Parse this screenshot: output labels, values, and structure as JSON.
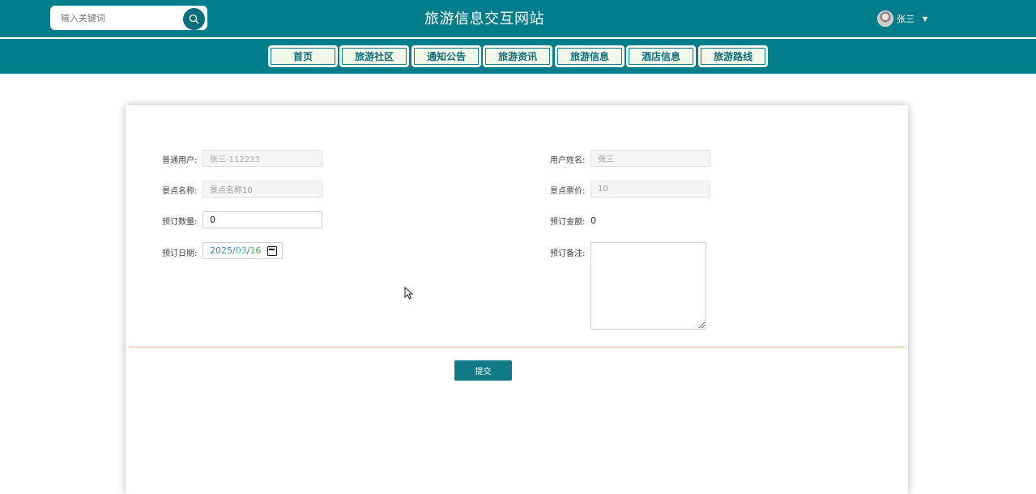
{
  "header": {
    "title": "旅游信息交互网站",
    "search_placeholder": "输入关键词",
    "user_name": "张三"
  },
  "nav": {
    "items": [
      {
        "label": "首页"
      },
      {
        "label": "旅游社区"
      },
      {
        "label": "通知公告"
      },
      {
        "label": "旅游资讯"
      },
      {
        "label": "旅游信息"
      },
      {
        "label": "酒店信息"
      },
      {
        "label": "旅游路线"
      }
    ]
  },
  "form": {
    "user_label": "普通用户:",
    "user_placeholder": "张三-112233",
    "name_label": "用户姓名:",
    "name_value": "张三",
    "spot_label": "景点名称:",
    "spot_value": "景点名称10",
    "price_label": "景点票价:",
    "price_value": "10",
    "qty_label": "预订数量:",
    "qty_value": "0",
    "amount_label": "预订金额:",
    "amount_value": "0",
    "date_label": "预订日期:",
    "date_year": "2025",
    "date_month": "03",
    "date_day": "16",
    "remark_label": "预订备注:",
    "submit_label": "提交"
  },
  "colors": {
    "header_bg": "#017d8c",
    "nav_item_bg": "#f1f7e9",
    "nav_text": "#0e6d79",
    "submit_bg": "#107b87",
    "divider": "#f0a88f"
  },
  "icons": {
    "search": "search-icon",
    "avatar": "avatar",
    "dropdown": "caret-down-icon",
    "calendar": "calendar-icon",
    "cursor": "mouse-pointer-icon"
  }
}
